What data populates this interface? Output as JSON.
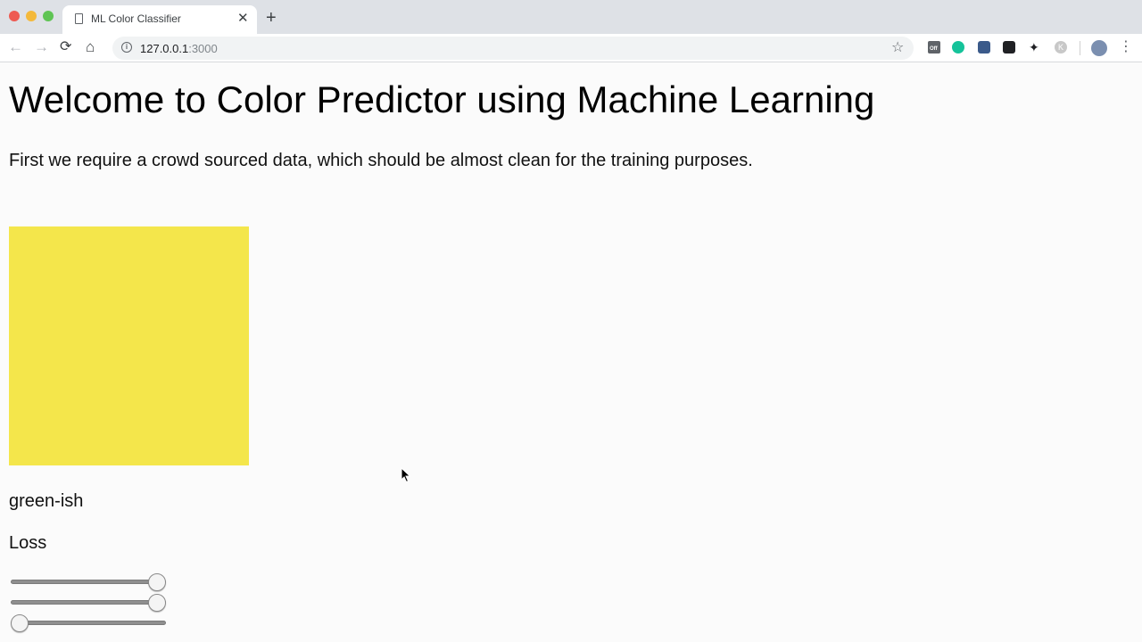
{
  "browser": {
    "tab_title": "ML Color Classifier",
    "tab_close": "✕",
    "new_tab": "+",
    "url_host": "127.0.0.1",
    "url_port": ":3000",
    "ext_off_label": "Off",
    "ext_k_label": "K"
  },
  "page": {
    "title": "Welcome to Color Predictor using Machine Learning",
    "intro": "First we require a crowd sourced data, which should be almost clean for the training purposes.",
    "swatch_color": "#f4e64b",
    "prediction": "green-ish",
    "loss_label": "Loss",
    "sliders": [
      {
        "value_fraction": 1.0
      },
      {
        "value_fraction": 1.0
      },
      {
        "value_fraction": 0.0
      }
    ]
  }
}
